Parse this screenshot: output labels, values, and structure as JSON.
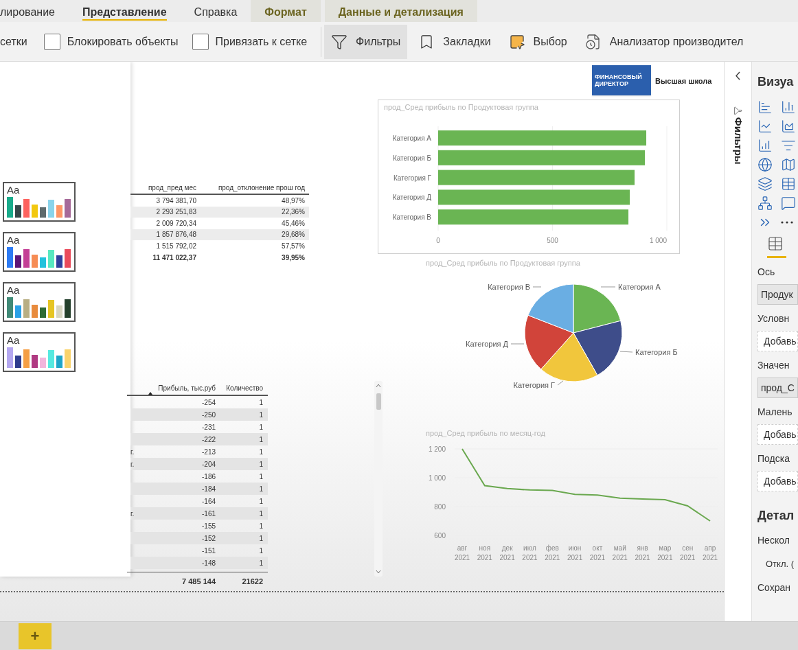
{
  "tabs": [
    {
      "label": "лирование",
      "selected": false,
      "contextual": false
    },
    {
      "label": "Представление",
      "selected": true,
      "contextual": false
    },
    {
      "label": "Справка",
      "selected": false,
      "contextual": false
    },
    {
      "label": "Формат",
      "selected": false,
      "contextual": true
    },
    {
      "label": "Данные и детализация",
      "selected": false,
      "contextual": true
    }
  ],
  "ribbon": [
    {
      "kind": "text",
      "label": "сетки"
    },
    {
      "kind": "checkbox",
      "label": "Блокировать объекты",
      "checked": false
    },
    {
      "kind": "checkbox",
      "label": "Привязать к сетке",
      "checked": false
    },
    {
      "kind": "divider"
    },
    {
      "kind": "button",
      "label": "Фильтры",
      "selected": true
    },
    {
      "kind": "button",
      "label": "Закладки",
      "selected": false
    },
    {
      "kind": "button",
      "label": "Выбор",
      "selected": false
    },
    {
      "kind": "button",
      "label": "Анализатор производител",
      "selected": false
    }
  ],
  "themes": [
    {
      "sample": "Aa",
      "bars": [
        {
          "color": "#1aab8b"
        },
        {
          "color": "#374649"
        },
        {
          "color": "#fd625e"
        },
        {
          "color": "#f2c80f"
        },
        {
          "color": "#5f6b6d"
        },
        {
          "color": "#8ad4eb"
        },
        {
          "color": "#fe9666"
        },
        {
          "color": "#a66999"
        }
      ]
    },
    {
      "sample": "Aa",
      "bars": [
        {
          "color": "#2d7bf4"
        },
        {
          "color": "#5d1578"
        },
        {
          "color": "#c43f96"
        },
        {
          "color": "#f68c54"
        },
        {
          "color": "#22c2dc"
        },
        {
          "color": "#58e8c0"
        },
        {
          "color": "#2f3f9c"
        },
        {
          "color": "#ea4b5b"
        }
      ]
    },
    {
      "sample": "Aa",
      "bars": [
        {
          "color": "#418a77"
        },
        {
          "color": "#2aa1e8"
        },
        {
          "color": "#b8ae83"
        },
        {
          "color": "#e88b3d"
        },
        {
          "color": "#2e6b34"
        },
        {
          "color": "#e6c523"
        },
        {
          "color": "#d7d6c2"
        },
        {
          "color": "#24402c"
        }
      ]
    },
    {
      "sample": "Aa",
      "bars": [
        {
          "color": "#b4a7f0"
        },
        {
          "color": "#2e3c8e"
        },
        {
          "color": "#f59f45"
        },
        {
          "color": "#b03a82"
        },
        {
          "color": "#f2b6dc"
        },
        {
          "color": "#56e9e0"
        },
        {
          "color": "#1ea5c8"
        },
        {
          "color": "#f9d36c"
        }
      ]
    }
  ],
  "table_1": {
    "columns": [
      "прод_пред мес",
      "прод_отклонение прош год"
    ],
    "rows": [
      [
        "3 794 381,70",
        "48,97%"
      ],
      [
        "2 293 251,83",
        "22,36%"
      ],
      [
        "2 009 720,34",
        "45,46%"
      ],
      [
        "1 857 876,48",
        "29,68%"
      ],
      [
        "1 515 792,02",
        "57,57%"
      ]
    ],
    "total": [
      "11 471 022,37",
      "39,95%"
    ]
  },
  "table_2": {
    "columns": [
      "Прибыль, тыс.руб",
      "Количество"
    ],
    "rows": [
      {
        "cells": [
          "-254",
          "1"
        ]
      },
      {
        "cells": [
          "-250",
          "1"
        ]
      },
      {
        "cells": [
          "-231",
          "1"
        ]
      },
      {
        "cells": [
          "-222",
          "1"
        ]
      },
      {
        "fragment": "г.",
        "cells": [
          "-213",
          "1"
        ]
      },
      {
        "fragment": "г.",
        "cells": [
          "-204",
          "1"
        ]
      },
      {
        "cells": [
          "-186",
          "1"
        ]
      },
      {
        "cells": [
          "-184",
          "1"
        ]
      },
      {
        "cells": [
          "-164",
          "1"
        ]
      },
      {
        "fragment": "г.",
        "cells": [
          "-161",
          "1"
        ]
      },
      {
        "cells": [
          "-155",
          "1"
        ]
      },
      {
        "cells": [
          "-152",
          "1"
        ]
      },
      {
        "cells": [
          "-151",
          "1"
        ]
      },
      {
        "cells": [
          "-148",
          "1"
        ]
      }
    ],
    "total": [
      "7 485 144",
      "21622"
    ]
  },
  "logo": {
    "mark": "ФИНАНСОВЫЙ ДИРЕКТОР",
    "name": "Высшая школа"
  },
  "bar_chart": {
    "chart_data": {
      "type": "bar",
      "orientation": "horizontal",
      "title": "прод_Сред прибыль по Продуктовая группа",
      "categories": [
        "Категория А",
        "Категория Б",
        "Категория Г",
        "Категория Д",
        "Категория В"
      ],
      "series": [
        {
          "color": "#6ab553",
          "values": [
            910,
            904,
            859,
            838,
            832
          ]
        }
      ],
      "xlim": [
        0,
        1000
      ],
      "xticks": [
        0,
        500,
        {
          "value": 1000,
          "label": "1 000"
        }
      ]
    }
  },
  "pie_chart": {
    "chart_data": {
      "type": "pie",
      "title": "прод_Сред прибыль по Продуктовая группа",
      "categories": [
        "Категория А",
        "Категория Б",
        "Категория Г",
        "Категория Д",
        "Категория В"
      ],
      "series": [
        {
          "values": [
            21,
            20.8,
            19.8,
            19.3,
            19.1
          ]
        }
      ],
      "colors": [
        "#6ab553",
        "#3e4d8a",
        "#f1c63c",
        "#d1443a",
        "#6aaee3"
      ]
    }
  },
  "line_chart": {
    "chart_data": {
      "type": "line",
      "title": "прод_Сред прибыль по месяц-год",
      "categories": [
        "авг 2021",
        "ноя 2021",
        "дек 2021",
        "июл 2021",
        "фев 2021",
        "июн 2021",
        "окт 2021",
        "май 2021",
        "янв 2021",
        "мар 2021",
        "сен 2021",
        "апр 2021"
      ],
      "series": [
        {
          "color": "#6aa84f",
          "values": [
            1200,
            945,
            925,
            915,
            912,
            885,
            880,
            858,
            852,
            848,
            805,
            700
          ]
        }
      ],
      "ylim": [
        600,
        1200
      ],
      "yticks": [
        600,
        800,
        {
          "value": 1000,
          "label": "1 000"
        },
        {
          "value": 1200,
          "label": "1 200"
        }
      ]
    }
  },
  "filters_pane": {
    "label": "Фильтры"
  },
  "visualizations": {
    "title": "Визуа",
    "wells": [
      {
        "label": "Ось",
        "field": "Продук",
        "filled": true
      },
      {
        "label": "Условн",
        "field": "Добавь",
        "filled": false
      },
      {
        "label": "Значен",
        "field": "прод_С",
        "filled": true
      },
      {
        "label": "Малень",
        "field": "Добавь",
        "filled": false
      },
      {
        "label": "Подска",
        "field": "Добавь",
        "filled": false
      }
    ],
    "drillthrough": {
      "title": "Детал",
      "option": "Нескол",
      "toggle": "Откл. (",
      "keep": "Сохран"
    }
  },
  "page_bar": {
    "add": "+"
  }
}
